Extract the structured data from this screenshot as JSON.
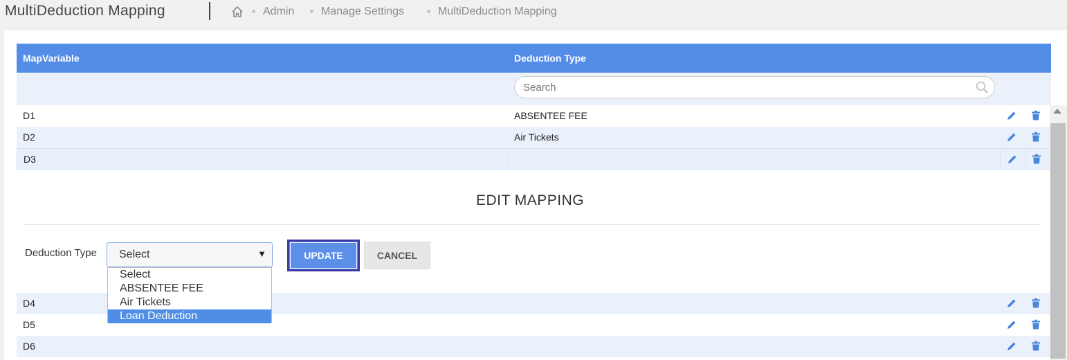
{
  "header": {
    "title": "MultiDeduction Mapping",
    "breadcrumb": [
      "Admin",
      "Manage Settings",
      "MultiDeduction Mapping"
    ]
  },
  "table": {
    "columns": [
      "MapVariable",
      "Deduction Type"
    ],
    "search_placeholder": "Search",
    "rows_top": [
      {
        "map": "D1",
        "type": "ABSENTEE FEE"
      },
      {
        "map": "D2",
        "type": "Air Tickets"
      },
      {
        "map": "D3",
        "type": ""
      }
    ],
    "rows_bottom": [
      {
        "map": "D4",
        "type": ""
      },
      {
        "map": "D5",
        "type": ""
      },
      {
        "map": "D6",
        "type": ""
      }
    ]
  },
  "edit": {
    "title": "EDIT MAPPING",
    "field_label": "Deduction Type",
    "selected": "Select",
    "options": [
      "Select",
      "ABSENTEE FEE",
      "Air Tickets",
      "Loan Deduction"
    ],
    "highlighted_option": "Loan Deduction",
    "update_label": "UPDATE",
    "cancel_label": "CANCEL"
  },
  "colors": {
    "header_blue": "#548de7",
    "row_alt": "#eaf1fb",
    "icon_blue": "#4a86d9"
  }
}
